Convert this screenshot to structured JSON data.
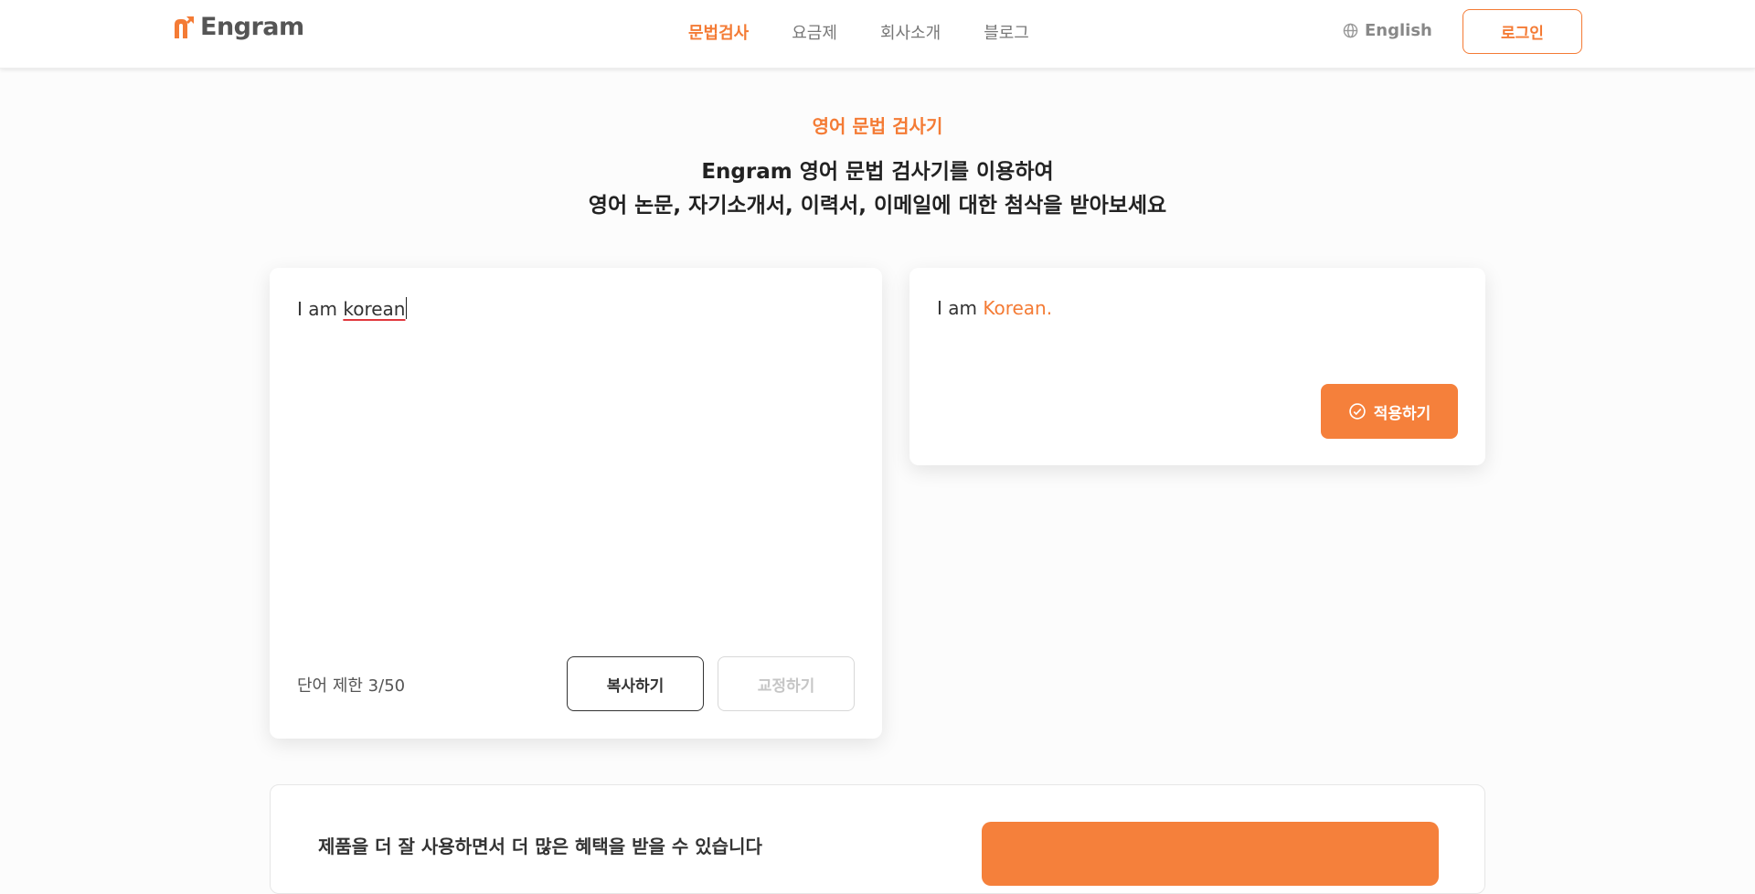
{
  "brand": {
    "name": "Engram",
    "accent_color": "#f47b35",
    "logo_icon": "engram-logo-icon"
  },
  "nav": {
    "items": [
      {
        "label": "문법검사",
        "active": true
      },
      {
        "label": "요금제",
        "active": false
      },
      {
        "label": "회사소개",
        "active": false
      },
      {
        "label": "블로그",
        "active": false
      }
    ]
  },
  "language": {
    "icon": "globe-icon",
    "label": "English"
  },
  "auth": {
    "login_label": "로그인"
  },
  "hero": {
    "eyebrow": "영어 문법 검사기",
    "headline_line1": "Engram 영어 문법 검사기를 이용하여",
    "headline_line2": "영어 논문, 자기소개서, 이력서, 이메일에 대한 첨삭을 받아보세요"
  },
  "editor": {
    "text_prefix": "I am ",
    "text_error": "korean",
    "error_underline_color": "#e0383e",
    "word_count": "단어 제한 3/50",
    "copy_label": "복사하기",
    "correct_label": "교정하기"
  },
  "result": {
    "text_prefix": "I am ",
    "text_correction": "Korean.",
    "apply_icon": "check-circle-icon",
    "apply_label": "적용하기"
  },
  "bottom": {
    "text": "제품을 더 잘 사용하면서 더 많은 혜택을 받을 수 있습니다"
  }
}
